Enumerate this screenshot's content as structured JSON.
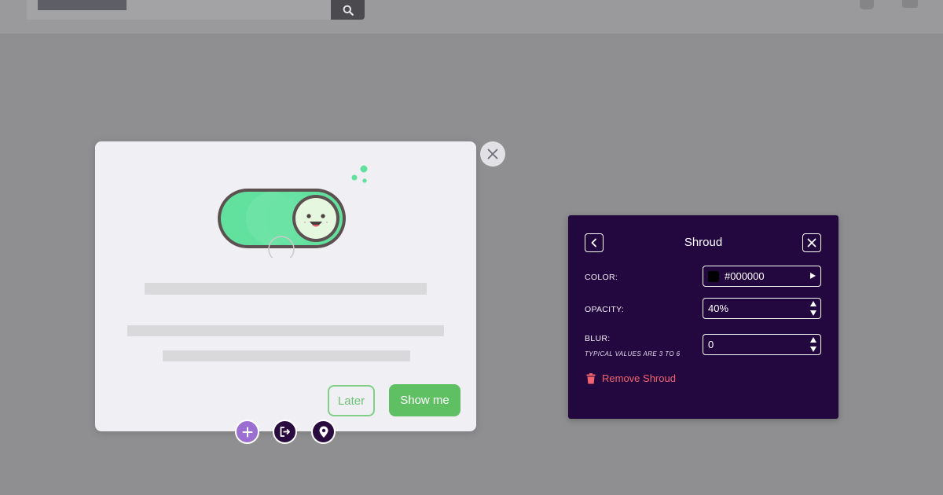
{
  "modal": {
    "later_label": "Later",
    "show_label": "Show me"
  },
  "panel": {
    "title": "Shroud",
    "color_label": "COLOR:",
    "color_value": "#000000",
    "opacity_label": "OPACITY:",
    "opacity_value": "40%",
    "blur_label": "BLUR:",
    "blur_hint": "TYPICAL VALUES ARE 3 TO 6",
    "blur_value": "0",
    "remove_label": "Remove Shroud"
  },
  "icons": {
    "search": "search-icon",
    "close": "close-icon",
    "back": "chevron-left-icon",
    "add": "plus-icon",
    "exit": "exit-icon",
    "pin": "location-pin-icon",
    "trash": "trash-icon"
  },
  "colors": {
    "panel_bg": "#230840",
    "primary_green": "#5fbf63",
    "remove_red": "#f0636e",
    "fab_purple": "#9b6fd1",
    "fab_dark": "#2a0b3f"
  }
}
